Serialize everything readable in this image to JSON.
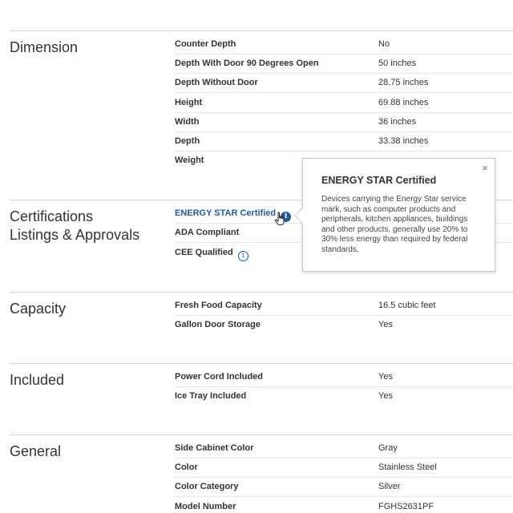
{
  "sections": [
    {
      "title": "Dimension",
      "rows": [
        {
          "label": "Counter Depth",
          "value": "No"
        },
        {
          "label": "Depth With Door 90 Degrees Open",
          "value": "50 inches"
        },
        {
          "label": "Depth Without Door",
          "value": "28.75 inches"
        },
        {
          "label": "Height",
          "value": "69.88 inches"
        },
        {
          "label": "Width",
          "value": "36 inches"
        },
        {
          "label": "Depth",
          "value": "33.38 inches"
        },
        {
          "label": "Weight",
          "value": ""
        }
      ]
    },
    {
      "title_line1": "Certifications",
      "title_line2": "Listings & Approvals",
      "rows": [
        {
          "label": "ENERGY STAR Certified",
          "value": ""
        },
        {
          "label": "ADA Compliant",
          "value": ""
        },
        {
          "label": "CEE Qualified",
          "value": ""
        }
      ]
    },
    {
      "title": "Capacity",
      "rows": [
        {
          "label": "Fresh Food Capacity",
          "value": "16.5 cubic feet"
        },
        {
          "label": "Gallon Door Storage",
          "value": "Yes"
        }
      ]
    },
    {
      "title": "Included",
      "rows": [
        {
          "label": "Power Cord Included",
          "value": "Yes"
        },
        {
          "label": "Ice Tray Included",
          "value": "Yes"
        }
      ]
    },
    {
      "title": "General",
      "rows": [
        {
          "label": "Side Cabinet Color",
          "value": "Gray"
        },
        {
          "label": "Color",
          "value": "Stainless Steel"
        },
        {
          "label": "Color Category",
          "value": "Silver"
        },
        {
          "label": "Model Number",
          "value": "FGHS2631PF"
        }
      ]
    }
  ],
  "popover": {
    "title": "ENERGY STAR Certified",
    "body": "Devices carrying the Energy Star service mark, such as computer products and peripherals, kitchen appliances, buildings and other products, generally use 20% to 30% less energy than required by federal standards.",
    "close": "×"
  },
  "icons": {
    "info_glyph": "i",
    "info_filled": "info-filled-icon",
    "info_outline": "info-outline-icon",
    "cursor": "hand-pointer-icon",
    "close": "close-icon"
  },
  "colors": {
    "link": "#1f5a9e",
    "divider": "#d6d6d6",
    "text": "#333333"
  }
}
